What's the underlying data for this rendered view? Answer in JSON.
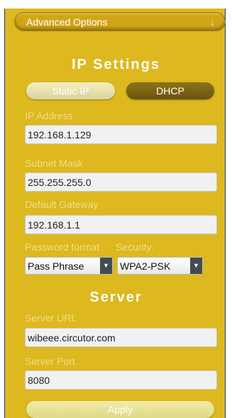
{
  "advanced_options": {
    "label": "Advanced Options",
    "arrow": "↓"
  },
  "ip_settings": {
    "title": "IP Settings",
    "mode_buttons": {
      "static": "Static IP",
      "dhcp": "DHCP",
      "selected": "DHCP"
    },
    "ip_address": {
      "label": "IP Address",
      "value": "192.168.1.129"
    },
    "subnet_mask": {
      "label": "Subnet Mask",
      "value": "255.255.255.0"
    },
    "default_gateway": {
      "label": "Default Gateway",
      "value": "192.168.1.1"
    },
    "password_format": {
      "label": "Password format",
      "value": "Pass Phrase"
    },
    "security": {
      "label": "Security:",
      "value": "WPA2-PSK"
    }
  },
  "server": {
    "title": "Server",
    "url": {
      "label": "Server URL",
      "value": "wibeee.circutor.com"
    },
    "port": {
      "label": "Server Port",
      "value": "8080"
    }
  },
  "apply_label": "Apply",
  "colors": {
    "panel": "#ddb81f",
    "bar": "#d2a518",
    "border": "#0f3f8c",
    "label": "#f1de86"
  },
  "icons": {
    "select_arrow": "triangle-down-icon",
    "expand_arrow": "arrow-down-icon"
  }
}
